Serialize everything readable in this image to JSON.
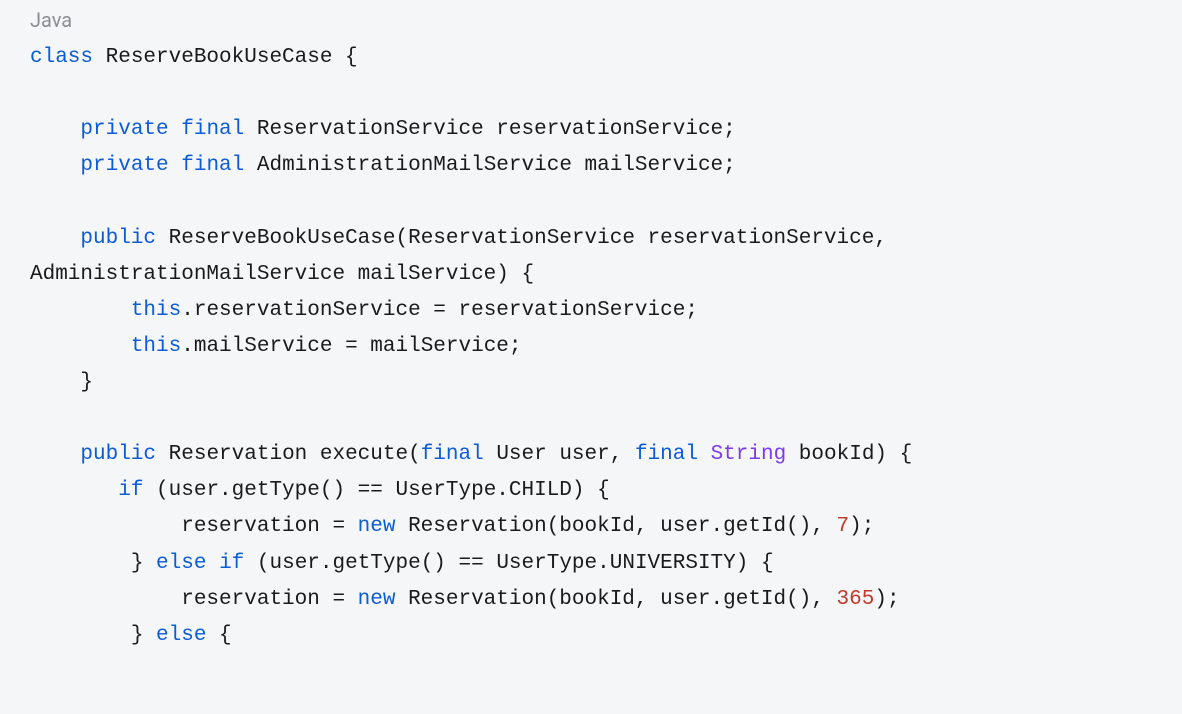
{
  "code": {
    "language": "Java",
    "tokens": [
      [
        {
          "text": "class",
          "cls": "kw"
        },
        {
          "text": " ReserveBookUseCase {",
          "cls": "plain"
        }
      ],
      [
        {
          "text": "",
          "cls": "plain"
        }
      ],
      [
        {
          "text": "    ",
          "cls": "plain"
        },
        {
          "text": "private",
          "cls": "kw"
        },
        {
          "text": " ",
          "cls": "plain"
        },
        {
          "text": "final",
          "cls": "kw"
        },
        {
          "text": " ReservationService reservationService;",
          "cls": "plain"
        }
      ],
      [
        {
          "text": "    ",
          "cls": "plain"
        },
        {
          "text": "private",
          "cls": "kw"
        },
        {
          "text": " ",
          "cls": "plain"
        },
        {
          "text": "final",
          "cls": "kw"
        },
        {
          "text": " AdministrationMailService mailService;",
          "cls": "plain"
        }
      ],
      [
        {
          "text": "",
          "cls": "plain"
        }
      ],
      [
        {
          "text": "    ",
          "cls": "plain"
        },
        {
          "text": "public",
          "cls": "kw"
        },
        {
          "text": " ReserveBookUseCase(ReservationService reservationService, ",
          "cls": "plain"
        }
      ],
      [
        {
          "text": "AdministrationMailService mailService) {",
          "cls": "plain"
        }
      ],
      [
        {
          "text": "        ",
          "cls": "plain"
        },
        {
          "text": "this",
          "cls": "kw"
        },
        {
          "text": ".reservationService = reservationService;",
          "cls": "plain"
        }
      ],
      [
        {
          "text": "        ",
          "cls": "plain"
        },
        {
          "text": "this",
          "cls": "kw"
        },
        {
          "text": ".mailService = mailService;",
          "cls": "plain"
        }
      ],
      [
        {
          "text": "    }",
          "cls": "plain"
        }
      ],
      [
        {
          "text": "",
          "cls": "plain"
        }
      ],
      [
        {
          "text": "    ",
          "cls": "plain"
        },
        {
          "text": "public",
          "cls": "kw"
        },
        {
          "text": " Reservation execute(",
          "cls": "plain"
        },
        {
          "text": "final",
          "cls": "kw"
        },
        {
          "text": " User user, ",
          "cls": "plain"
        },
        {
          "text": "final",
          "cls": "kw"
        },
        {
          "text": " ",
          "cls": "plain"
        },
        {
          "text": "String",
          "cls": "type"
        },
        {
          "text": " bookId) {",
          "cls": "plain"
        }
      ],
      [
        {
          "text": "       ",
          "cls": "plain"
        },
        {
          "text": "if",
          "cls": "kw"
        },
        {
          "text": " (user.getType() == UserType.CHILD) {",
          "cls": "plain"
        }
      ],
      [
        {
          "text": "            reservation = ",
          "cls": "plain"
        },
        {
          "text": "new",
          "cls": "kw"
        },
        {
          "text": " Reservation(bookId, user.getId(), ",
          "cls": "plain"
        },
        {
          "text": "7",
          "cls": "num"
        },
        {
          "text": ");",
          "cls": "plain"
        }
      ],
      [
        {
          "text": "        } ",
          "cls": "plain"
        },
        {
          "text": "else",
          "cls": "kw"
        },
        {
          "text": " ",
          "cls": "plain"
        },
        {
          "text": "if",
          "cls": "kw"
        },
        {
          "text": " (user.getType() == UserType.UNIVERSITY) {",
          "cls": "plain"
        }
      ],
      [
        {
          "text": "            reservation = ",
          "cls": "plain"
        },
        {
          "text": "new",
          "cls": "kw"
        },
        {
          "text": " Reservation(bookId, user.getId(), ",
          "cls": "plain"
        },
        {
          "text": "365",
          "cls": "num"
        },
        {
          "text": ");",
          "cls": "plain"
        }
      ],
      [
        {
          "text": "        } ",
          "cls": "plain"
        },
        {
          "text": "else",
          "cls": "kw"
        },
        {
          "text": " {",
          "cls": "plain"
        }
      ]
    ]
  }
}
